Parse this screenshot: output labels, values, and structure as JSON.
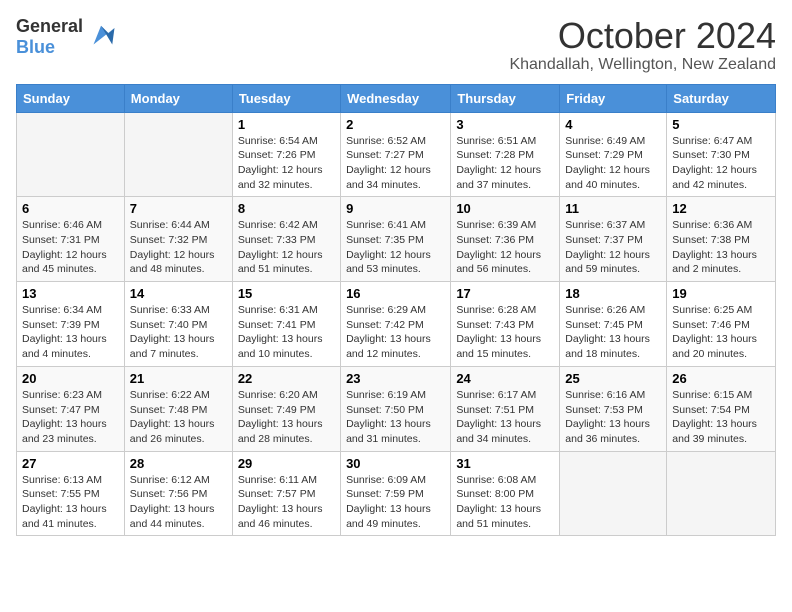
{
  "header": {
    "logo_general": "General",
    "logo_blue": "Blue",
    "month": "October 2024",
    "location": "Khandallah, Wellington, New Zealand"
  },
  "weekdays": [
    "Sunday",
    "Monday",
    "Tuesday",
    "Wednesday",
    "Thursday",
    "Friday",
    "Saturday"
  ],
  "weeks": [
    [
      {
        "day": "",
        "sunrise": "",
        "sunset": "",
        "daylight": ""
      },
      {
        "day": "",
        "sunrise": "",
        "sunset": "",
        "daylight": ""
      },
      {
        "day": "1",
        "sunrise": "Sunrise: 6:54 AM",
        "sunset": "Sunset: 7:26 PM",
        "daylight": "Daylight: 12 hours and 32 minutes."
      },
      {
        "day": "2",
        "sunrise": "Sunrise: 6:52 AM",
        "sunset": "Sunset: 7:27 PM",
        "daylight": "Daylight: 12 hours and 34 minutes."
      },
      {
        "day": "3",
        "sunrise": "Sunrise: 6:51 AM",
        "sunset": "Sunset: 7:28 PM",
        "daylight": "Daylight: 12 hours and 37 minutes."
      },
      {
        "day": "4",
        "sunrise": "Sunrise: 6:49 AM",
        "sunset": "Sunset: 7:29 PM",
        "daylight": "Daylight: 12 hours and 40 minutes."
      },
      {
        "day": "5",
        "sunrise": "Sunrise: 6:47 AM",
        "sunset": "Sunset: 7:30 PM",
        "daylight": "Daylight: 12 hours and 42 minutes."
      }
    ],
    [
      {
        "day": "6",
        "sunrise": "Sunrise: 6:46 AM",
        "sunset": "Sunset: 7:31 PM",
        "daylight": "Daylight: 12 hours and 45 minutes."
      },
      {
        "day": "7",
        "sunrise": "Sunrise: 6:44 AM",
        "sunset": "Sunset: 7:32 PM",
        "daylight": "Daylight: 12 hours and 48 minutes."
      },
      {
        "day": "8",
        "sunrise": "Sunrise: 6:42 AM",
        "sunset": "Sunset: 7:33 PM",
        "daylight": "Daylight: 12 hours and 51 minutes."
      },
      {
        "day": "9",
        "sunrise": "Sunrise: 6:41 AM",
        "sunset": "Sunset: 7:35 PM",
        "daylight": "Daylight: 12 hours and 53 minutes."
      },
      {
        "day": "10",
        "sunrise": "Sunrise: 6:39 AM",
        "sunset": "Sunset: 7:36 PM",
        "daylight": "Daylight: 12 hours and 56 minutes."
      },
      {
        "day": "11",
        "sunrise": "Sunrise: 6:37 AM",
        "sunset": "Sunset: 7:37 PM",
        "daylight": "Daylight: 12 hours and 59 minutes."
      },
      {
        "day": "12",
        "sunrise": "Sunrise: 6:36 AM",
        "sunset": "Sunset: 7:38 PM",
        "daylight": "Daylight: 13 hours and 2 minutes."
      }
    ],
    [
      {
        "day": "13",
        "sunrise": "Sunrise: 6:34 AM",
        "sunset": "Sunset: 7:39 PM",
        "daylight": "Daylight: 13 hours and 4 minutes."
      },
      {
        "day": "14",
        "sunrise": "Sunrise: 6:33 AM",
        "sunset": "Sunset: 7:40 PM",
        "daylight": "Daylight: 13 hours and 7 minutes."
      },
      {
        "day": "15",
        "sunrise": "Sunrise: 6:31 AM",
        "sunset": "Sunset: 7:41 PM",
        "daylight": "Daylight: 13 hours and 10 minutes."
      },
      {
        "day": "16",
        "sunrise": "Sunrise: 6:29 AM",
        "sunset": "Sunset: 7:42 PM",
        "daylight": "Daylight: 13 hours and 12 minutes."
      },
      {
        "day": "17",
        "sunrise": "Sunrise: 6:28 AM",
        "sunset": "Sunset: 7:43 PM",
        "daylight": "Daylight: 13 hours and 15 minutes."
      },
      {
        "day": "18",
        "sunrise": "Sunrise: 6:26 AM",
        "sunset": "Sunset: 7:45 PM",
        "daylight": "Daylight: 13 hours and 18 minutes."
      },
      {
        "day": "19",
        "sunrise": "Sunrise: 6:25 AM",
        "sunset": "Sunset: 7:46 PM",
        "daylight": "Daylight: 13 hours and 20 minutes."
      }
    ],
    [
      {
        "day": "20",
        "sunrise": "Sunrise: 6:23 AM",
        "sunset": "Sunset: 7:47 PM",
        "daylight": "Daylight: 13 hours and 23 minutes."
      },
      {
        "day": "21",
        "sunrise": "Sunrise: 6:22 AM",
        "sunset": "Sunset: 7:48 PM",
        "daylight": "Daylight: 13 hours and 26 minutes."
      },
      {
        "day": "22",
        "sunrise": "Sunrise: 6:20 AM",
        "sunset": "Sunset: 7:49 PM",
        "daylight": "Daylight: 13 hours and 28 minutes."
      },
      {
        "day": "23",
        "sunrise": "Sunrise: 6:19 AM",
        "sunset": "Sunset: 7:50 PM",
        "daylight": "Daylight: 13 hours and 31 minutes."
      },
      {
        "day": "24",
        "sunrise": "Sunrise: 6:17 AM",
        "sunset": "Sunset: 7:51 PM",
        "daylight": "Daylight: 13 hours and 34 minutes."
      },
      {
        "day": "25",
        "sunrise": "Sunrise: 6:16 AM",
        "sunset": "Sunset: 7:53 PM",
        "daylight": "Daylight: 13 hours and 36 minutes."
      },
      {
        "day": "26",
        "sunrise": "Sunrise: 6:15 AM",
        "sunset": "Sunset: 7:54 PM",
        "daylight": "Daylight: 13 hours and 39 minutes."
      }
    ],
    [
      {
        "day": "27",
        "sunrise": "Sunrise: 6:13 AM",
        "sunset": "Sunset: 7:55 PM",
        "daylight": "Daylight: 13 hours and 41 minutes."
      },
      {
        "day": "28",
        "sunrise": "Sunrise: 6:12 AM",
        "sunset": "Sunset: 7:56 PM",
        "daylight": "Daylight: 13 hours and 44 minutes."
      },
      {
        "day": "29",
        "sunrise": "Sunrise: 6:11 AM",
        "sunset": "Sunset: 7:57 PM",
        "daylight": "Daylight: 13 hours and 46 minutes."
      },
      {
        "day": "30",
        "sunrise": "Sunrise: 6:09 AM",
        "sunset": "Sunset: 7:59 PM",
        "daylight": "Daylight: 13 hours and 49 minutes."
      },
      {
        "day": "31",
        "sunrise": "Sunrise: 6:08 AM",
        "sunset": "Sunset: 8:00 PM",
        "daylight": "Daylight: 13 hours and 51 minutes."
      },
      {
        "day": "",
        "sunrise": "",
        "sunset": "",
        "daylight": ""
      },
      {
        "day": "",
        "sunrise": "",
        "sunset": "",
        "daylight": ""
      }
    ]
  ]
}
